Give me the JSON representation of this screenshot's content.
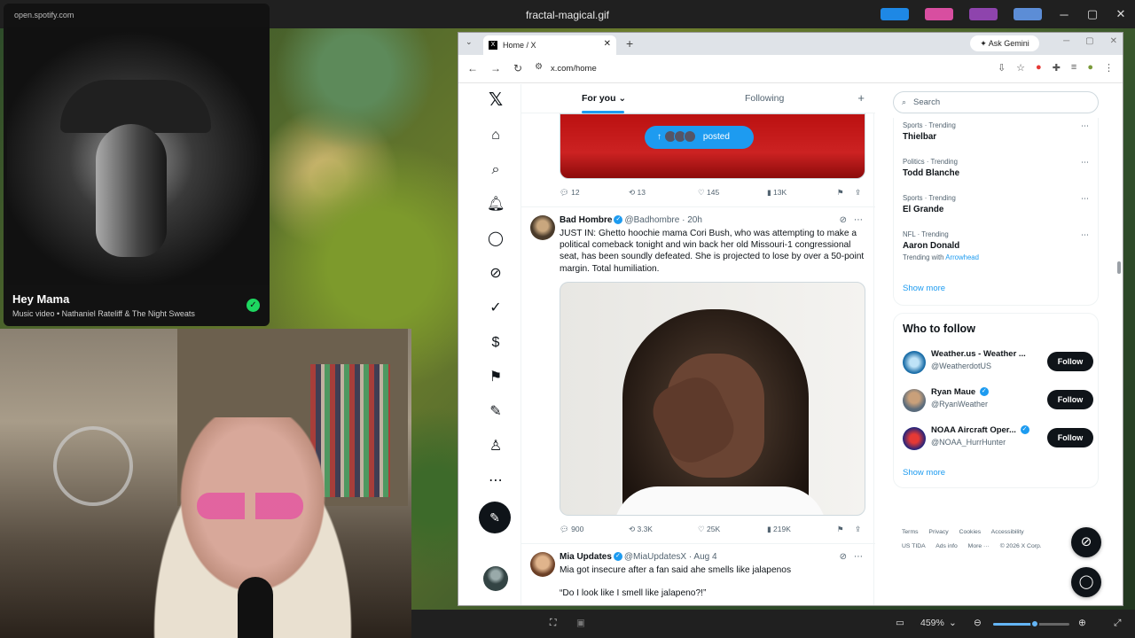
{
  "window": {
    "title": "fractal-magical.gif"
  },
  "spotify": {
    "url": "open.spotify.com",
    "song": "Hey Mama",
    "meta": "Music video • Nathaniel Rateliff & The Night Sweats"
  },
  "browser": {
    "tab_title": "Home / X",
    "ask_gemini": "Ask Gemini",
    "url": "x.com/home"
  },
  "feed": {
    "tab_for_you": "For you",
    "tab_following": "Following",
    "pill_label": "posted",
    "post1_actions": {
      "replies": "12",
      "reposts": "13",
      "likes": "145",
      "views": "13K"
    },
    "post2": {
      "name": "Bad Hombre",
      "handle": "@Badhombre · 20h",
      "text": "JUST IN: Ghetto hoochie mama Cori Bush, who was attempting to make a political comeback tonight and win back her old Missouri-1 congressional seat, has been soundly defeated. She is projected to lose by over a 50-point margin. Total humiliation.",
      "replies": "900",
      "reposts": "3.3K",
      "likes": "25K",
      "views": "219K"
    },
    "post3": {
      "name": "Mia Updates",
      "handle": "@MiaUpdatesX · Aug 4",
      "text": "Mia got insecure after a fan said ahe smells like jalapenos",
      "quote": "“Do I look like I smell like jalapeno?!”"
    }
  },
  "sidebar": {
    "search_placeholder": "Search",
    "trends": [
      {
        "category": "Sports · Trending",
        "title": "Thielbar"
      },
      {
        "category": "Politics · Trending",
        "title": "Todd Blanche"
      },
      {
        "category": "Sports · Trending",
        "title": "El Grande"
      },
      {
        "category": "NFL · Trending",
        "title": "Aaron Donald",
        "with_prefix": "Trending with",
        "with_link": "Arrowhead"
      }
    ],
    "show_more": "Show more",
    "who_to_follow": "Who to follow",
    "accounts": [
      {
        "name": "Weather.us - Weather ...",
        "handle": "@WeatherdotUS",
        "follow": "Follow"
      },
      {
        "name": "Ryan Maue",
        "handle": "@RyanWeather",
        "follow": "Follow"
      },
      {
        "name": "NOAA Aircraft Oper...",
        "handle": "@NOAA_HurrHunter",
        "follow": "Follow"
      }
    ],
    "show_more_2": "Show more",
    "footer": [
      "Terms",
      "Privacy",
      "Cookies",
      "Accessibility",
      "US TIDA",
      "Ads info",
      "More ···",
      "© 2026 X Corp."
    ]
  },
  "viewer": {
    "zoom": "459%",
    "zoom_level": 0.55
  }
}
